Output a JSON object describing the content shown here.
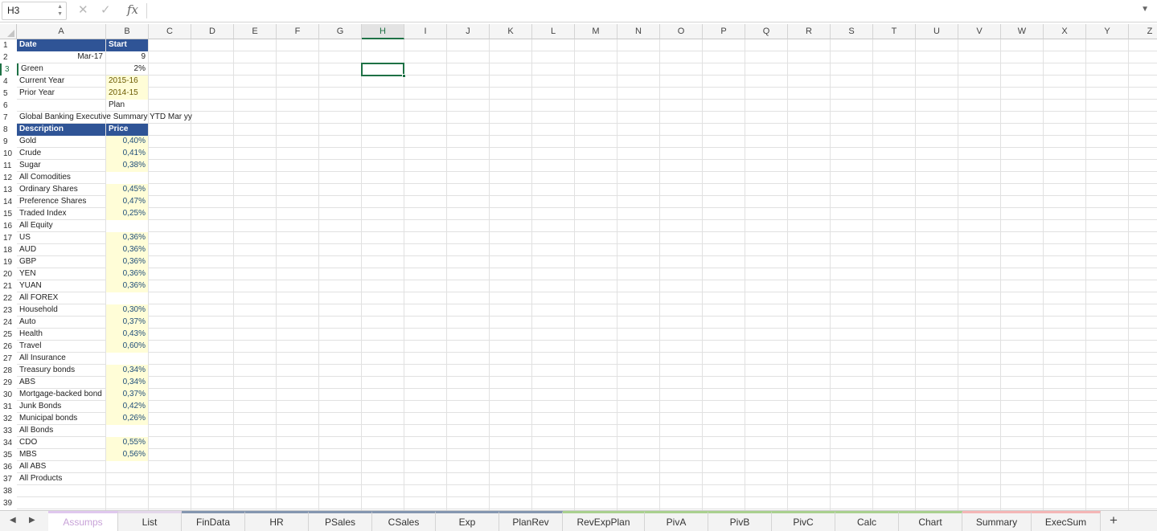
{
  "formula_bar": {
    "name_box": "H3",
    "cancel_icon": "✕",
    "enter_icon": "✓",
    "fx_label": "fx",
    "formula": ""
  },
  "columns": [
    "A",
    "B",
    "C",
    "D",
    "E",
    "F",
    "G",
    "H",
    "I",
    "J",
    "K",
    "L",
    "M",
    "N",
    "O",
    "P",
    "Q",
    "R",
    "S",
    "T",
    "U",
    "V",
    "W",
    "X",
    "Y",
    "Z"
  ],
  "selected_cell": "H3",
  "rows": [
    "1",
    "2",
    "3",
    "4",
    "5",
    "6",
    "7",
    "8",
    "9",
    "10",
    "11",
    "12",
    "13",
    "14",
    "15",
    "16",
    "17",
    "18",
    "19",
    "20",
    "21",
    "22",
    "23",
    "24",
    "25",
    "26",
    "27",
    "28",
    "29",
    "30",
    "31",
    "32",
    "33",
    "34",
    "35",
    "36",
    "37",
    "38",
    "39"
  ],
  "cells": {
    "A1": "Date",
    "B1": "Start",
    "A2": "Mar-17",
    "B2": "9",
    "A3": "Green",
    "B3": "2%",
    "A4": "Current Year",
    "B4": "2015-16",
    "A5": "Prior Year",
    "B5": "2014-15",
    "B6": "Plan",
    "A7": "Global Banking Executive Summary YTD Mar yy",
    "A8": "Description",
    "B8": "Price",
    "A9": "Gold",
    "B9": "0,40%",
    "A10": "Crude",
    "B10": "0,41%",
    "A11": "Sugar",
    "B11": "0,38%",
    "A12": "All Comodities",
    "A13": "Ordinary Shares",
    "B13": "0,45%",
    "A14": "Preference Shares",
    "B14": "0,47%",
    "A15": "Traded Index",
    "B15": "0,25%",
    "A16": "All Equity",
    "A17": "US",
    "B17": "0,36%",
    "A18": "AUD",
    "B18": "0,36%",
    "A19": "GBP",
    "B19": "0,36%",
    "A20": "YEN",
    "B20": "0,36%",
    "A21": "YUAN",
    "B21": "0,36%",
    "A22": "All FOREX",
    "A23": "Household",
    "B23": "0,30%",
    "A24": "Auto",
    "B24": "0,37%",
    "A25": "Health",
    "B25": "0,43%",
    "A26": "Travel",
    "B26": "0,60%",
    "A27": "All Insurance",
    "A28": "Treasury bonds",
    "B28": "0,34%",
    "A29": "ABS",
    "B29": "0,34%",
    "A30": "Mortgage-backed bond",
    "B30": "0,37%",
    "A31": "Junk Bonds",
    "B31": "0,42%",
    "A32": "Municipal bonds",
    "B32": "0,26%",
    "A33": "All Bonds",
    "A34": "CDO",
    "B34": "0,55%",
    "A35": "MBS",
    "B35": "0,56%",
    "A36": "All ABS",
    "A37": "All Products"
  },
  "sheet_tabs": [
    {
      "label": "Assumps",
      "color": "#e0c8ee",
      "active": true
    },
    {
      "label": "List",
      "color": "#e4d7ea",
      "active": false
    },
    {
      "label": "FinData",
      "color": "#8496b0",
      "active": false
    },
    {
      "label": "HR",
      "color": "#8496b0",
      "active": false
    },
    {
      "label": "PSales",
      "color": "#8496b0",
      "active": false
    },
    {
      "label": "CSales",
      "color": "#8496b0",
      "active": false
    },
    {
      "label": "Exp",
      "color": "#8496b0",
      "active": false
    },
    {
      "label": "PlanRev",
      "color": "#8496b0",
      "active": false
    },
    {
      "label": "RevExpPlan",
      "color": "#a9d08e",
      "active": false
    },
    {
      "label": "PivA",
      "color": "#a9d08e",
      "active": false
    },
    {
      "label": "PivB",
      "color": "#a9d08e",
      "active": false
    },
    {
      "label": "PivC",
      "color": "#a9d08e",
      "active": false
    },
    {
      "label": "Calc",
      "color": "#a9d08e",
      "active": false
    },
    {
      "label": "Chart",
      "color": "#a9d08e",
      "active": false
    },
    {
      "label": "Summary",
      "color": "#f4b6b6",
      "active": false
    },
    {
      "label": "ExecSum",
      "color": "#f4b6b6",
      "active": false
    }
  ],
  "tab_nav": {
    "prev_icon": "◀",
    "next_icon": "▶",
    "add_icon": "+"
  }
}
